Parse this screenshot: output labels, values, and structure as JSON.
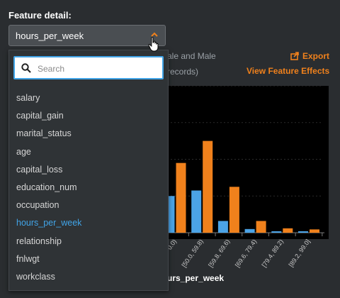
{
  "feature_label": "Feature detail:",
  "selected_feature": "hours_per_week",
  "search": {
    "placeholder": "Search",
    "value": ""
  },
  "options": [
    "salary",
    "capital_gain",
    "marital_status",
    "age",
    "capital_loss",
    "education_num",
    "occupation",
    "hours_per_week",
    "relationship",
    "fnlwgt",
    "workclass"
  ],
  "background": {
    "subtitle_line1": "ale and Male",
    "subtitle_line2": "records)",
    "export_label": "Export",
    "view_effects_label": "View Feature Effects",
    "axis_title": "urs_per_week"
  },
  "chart_data": {
    "type": "bar",
    "categories": [
      "0.0)",
      "[50.0, 59.8)",
      "[59.8, 69.6)",
      "[69.6, 79.4)",
      "[79.4, 89.2)",
      "[89.2, 99.0]"
    ],
    "series": [
      {
        "color": "#4ba3e6",
        "values": [
          10,
          11.5,
          3.2,
          1.0,
          0.4,
          0.4
        ]
      },
      {
        "color": "#f0811c",
        "values": [
          19,
          25,
          12.5,
          3.2,
          1.2,
          0.9
        ]
      }
    ],
    "ylim": [
      0,
      40
    ]
  },
  "colors": {
    "accent": "#f0811c",
    "selection": "#41a4e7"
  }
}
